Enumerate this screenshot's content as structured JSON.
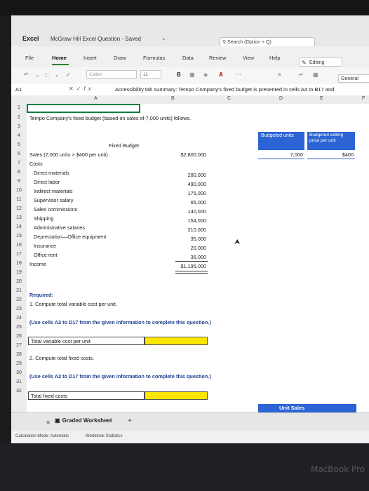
{
  "app": {
    "name": "Excel",
    "doc_title": "McGraw Hill Excel Question - Saved",
    "search_placeholder": "Search (Option + Q)"
  },
  "ribbon": {
    "tabs": [
      "File",
      "Home",
      "Insert",
      "Draw",
      "Formulas",
      "Data",
      "Review",
      "View",
      "Help"
    ],
    "active_tab": "Home",
    "editing_label": "Editing",
    "font_name": "Calibri",
    "font_size": "11",
    "bold_label": "B",
    "number_format": "General"
  },
  "formula_bar": {
    "cell_ref": "A1",
    "fx_label": "fx",
    "content": "Accessibility tab summary: Tempo Company's fixed budget is presented in cells A4 to B17 and"
  },
  "columns": [
    "A",
    "B",
    "C",
    "D",
    "E",
    "F"
  ],
  "rows": [
    "1",
    "2",
    "3",
    "4",
    "5",
    "6",
    "7",
    "8",
    "9",
    "10",
    "11",
    "12",
    "13",
    "14",
    "15",
    "16",
    "17",
    "18",
    "19",
    "20",
    "21",
    "22",
    "23",
    "24",
    "25",
    "26",
    "27",
    "28",
    "29",
    "30",
    "31",
    "32"
  ],
  "sheet": {
    "r2_title": "Tempo Company's fixed budget (based on sales of 7,000 units) follows.",
    "r4_fixed_budget": "Fixed Budget",
    "r4_budgeted_units": "Budgeted units",
    "r4_budgeted_price": "Budgeted selling price per unit",
    "r5_sales_label": "Sales (7,000 units × $400 per unit)",
    "r5_sales_value": "$2,800,000",
    "r5_units_value": "7,000",
    "r5_price_value": "$400",
    "r6_costs": "Costs",
    "cost_items": [
      {
        "label": "Direct materials",
        "value": "280,000"
      },
      {
        "label": "Direct labor",
        "value": "490,000"
      },
      {
        "label": "Indirect materials",
        "value": "175,000"
      },
      {
        "label": "Supervisor salary",
        "value": "65,000"
      },
      {
        "label": "Sales commissions",
        "value": "140,000"
      },
      {
        "label": "Shipping",
        "value": "154,000"
      },
      {
        "label": "Administrative salaries",
        "value": "210,000"
      },
      {
        "label": "Depreciation—Office equipment",
        "value": "35,000"
      },
      {
        "label": "Insurance",
        "value": "20,000"
      },
      {
        "label": "Office rent",
        "value": "36,000"
      }
    ],
    "r17_income_label": "Income",
    "r17_income_value": "$1,195,000",
    "r19_required": "Required:",
    "r20_q1": "1. Compute total variable cost per unit.",
    "r22_hint": "(Use cells A2 to D17 from the given information to complete this question.)",
    "r24_label": "Total variable cost per unit",
    "r26_q2": "2. Compute total fixed costs.",
    "r28_hint": "(Use cells A2 to D17 from the given information to complete this question.)",
    "r30_label": "Total fixed costs",
    "r31_unit_sales": "Unit Sales"
  },
  "sheet_tabs": {
    "active": "Graded Worksheet",
    "add_label": "+"
  },
  "status_bar": {
    "calc_mode": "Calculation Mode: Automatic",
    "workbook_stats": "Workbook Statistics"
  },
  "device_label": "MacBook Pro",
  "colors": {
    "accent_green": "#2e7d32",
    "highlight_yellow": "#ffe600",
    "header_blue": "#2c64d6"
  }
}
